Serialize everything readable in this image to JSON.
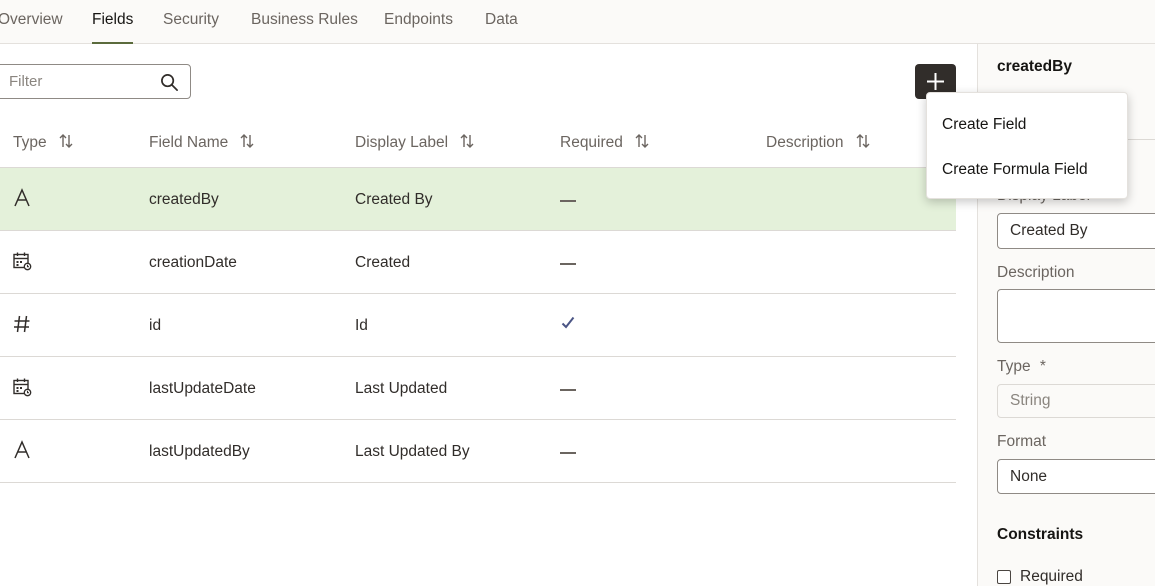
{
  "tabs": [
    {
      "label": "Overview"
    },
    {
      "label": "Fields",
      "active": true
    },
    {
      "label": "Security"
    },
    {
      "label": "Business Rules"
    },
    {
      "label": "Endpoints"
    },
    {
      "label": "Data"
    }
  ],
  "filter": {
    "placeholder": "Filter",
    "value": "",
    "icon": "search-icon"
  },
  "add_button": {
    "icon": "plus-icon"
  },
  "table": {
    "columns": [
      "Type",
      "Field Name",
      "Display Label",
      "Required",
      "Description"
    ],
    "rows": [
      {
        "type_icon": "text-type-icon",
        "name": "createdBy",
        "label": "Created By",
        "required": false,
        "description": "",
        "selected": true
      },
      {
        "type_icon": "date-type-icon",
        "name": "creationDate",
        "label": "Created",
        "required": false,
        "description": ""
      },
      {
        "type_icon": "number-type-icon",
        "name": "id",
        "label": "Id",
        "required": true,
        "description": ""
      },
      {
        "type_icon": "date-type-icon",
        "name": "lastUpdateDate",
        "label": "Last Updated",
        "required": false,
        "description": ""
      },
      {
        "type_icon": "text-type-icon",
        "name": "lastUpdatedBy",
        "label": "Last Updated By",
        "required": false,
        "description": ""
      }
    ]
  },
  "menu": {
    "items": [
      "Create Field",
      "Create Formula Field"
    ]
  },
  "panel": {
    "title": "createdBy",
    "display_label_label": "Display Label",
    "display_label_value": "Created By",
    "description_label": "Description",
    "description_value": "",
    "type_label": "Type",
    "type_required_mark": "*",
    "type_value": "String",
    "format_label": "Format",
    "format_value": "None",
    "constraints_title": "Constraints",
    "required_label": "Required",
    "required_checked": false
  },
  "colors": {
    "accent": "#5b6b3c",
    "selected_row": "#e4f1da",
    "dark_button": "#312d2a"
  }
}
